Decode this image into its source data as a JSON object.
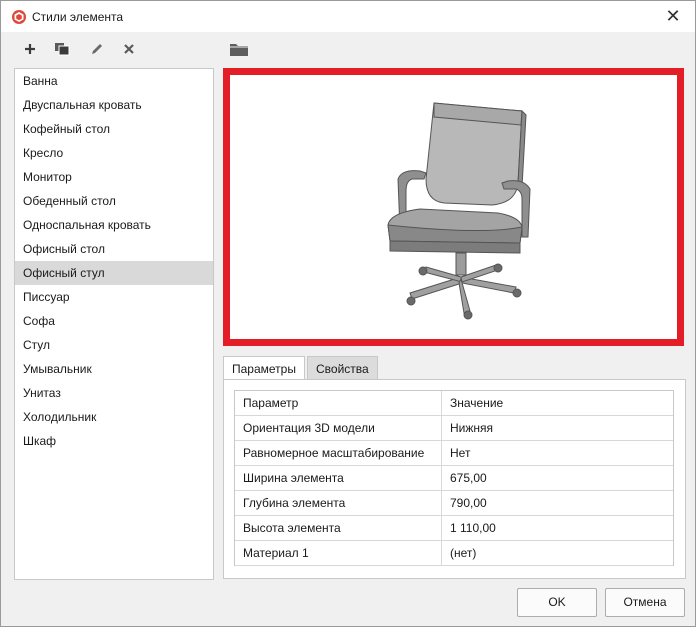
{
  "window": {
    "title": "Стили элемента",
    "close_glyph": "✕"
  },
  "toolbar": {
    "buttons": [
      {
        "icon": "plus-icon"
      },
      {
        "icon": "copy-icon"
      },
      {
        "icon": "pencil-icon"
      },
      {
        "icon": "delete-icon"
      }
    ],
    "folder_icon": "folder-icon"
  },
  "styles_list": {
    "items": [
      "Ванна",
      "Двуспальная кровать",
      "Кофейный стол",
      "Кресло",
      "Монитор",
      "Обеденный стол",
      "Односпальная кровать",
      "Офисный стол",
      "Офисный стул",
      "Писсуар",
      "Софа",
      "Стул",
      "Умывальник",
      "Унитаз",
      "Холодильник",
      "Шкаф"
    ],
    "selected": "Офисный стул"
  },
  "preview": {
    "border_color": "#e41e26",
    "image": "office-chair-3d"
  },
  "tabs": [
    {
      "label": "Параметры",
      "active": true
    },
    {
      "label": "Свойства",
      "active": false
    }
  ],
  "params": {
    "header": {
      "name": "Параметр",
      "value": "Значение"
    },
    "rows": [
      {
        "name": "Ориентация 3D модели",
        "value": "Нижняя"
      },
      {
        "name": "Равномерное масштабирование",
        "value": "Нет"
      },
      {
        "name": "Ширина элемента",
        "value": "675,00"
      },
      {
        "name": "Глубина  элемента",
        "value": "790,00"
      },
      {
        "name": "Высота элемента",
        "value": "1 110,00"
      },
      {
        "name": "Материал 1",
        "value": "(нет)"
      }
    ]
  },
  "buttons": {
    "ok": "OK",
    "cancel": "Отмена"
  }
}
